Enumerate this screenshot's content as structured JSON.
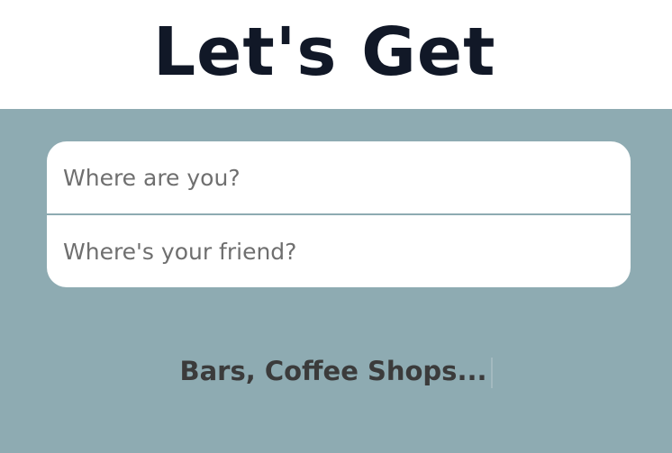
{
  "header": {
    "title": "Let's Get"
  },
  "form": {
    "location_placeholder": "Where are you?",
    "friend_placeholder": "Where's your friend?"
  },
  "typed": {
    "text": "Bars, Coffee Shops..."
  },
  "colors": {
    "panel_background": "#8eabb2",
    "title_text": "#111827",
    "typed_text": "#3b3b3b"
  }
}
